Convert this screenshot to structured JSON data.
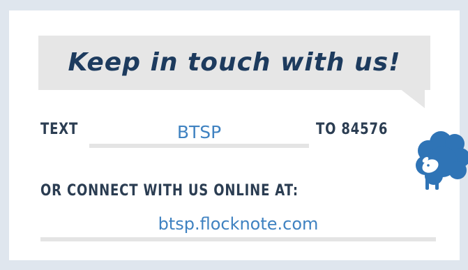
{
  "card": {
    "headline": "Keep in touch with us!",
    "text_prefix": "TEXT",
    "keyword": "BTSP",
    "text_suffix": "TO 84576",
    "connect_label": "OR CONNECT WITH US ONLINE AT:",
    "url": "btsp.flocknote.com"
  },
  "icons": {
    "sheep": "sheep-icon"
  },
  "colors": {
    "headline": "#1d3b5e",
    "accent_blue": "#3f82c1",
    "label_dark": "#2b3d52",
    "bubble_gray": "#e6e6e6",
    "frame": "#dfe6ee"
  }
}
